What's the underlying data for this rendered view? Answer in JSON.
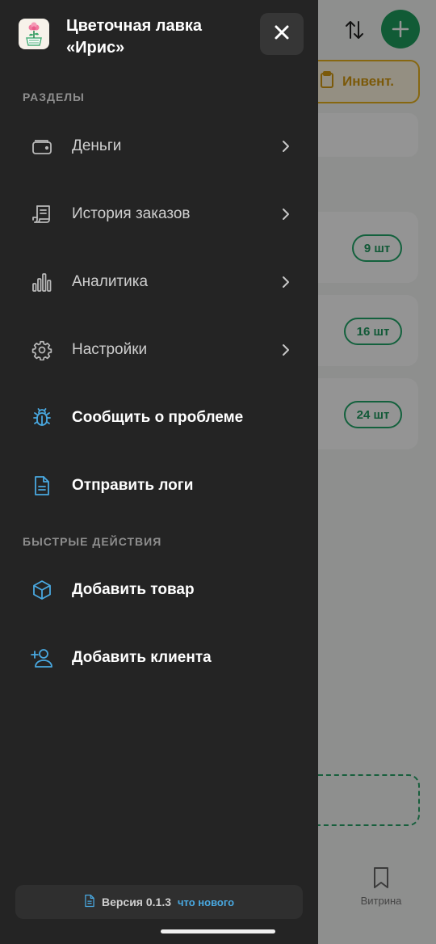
{
  "app": {
    "title": "Цветочная лавка «Ирис»"
  },
  "sections": {
    "main_label": "РАЗДЕЛЫ",
    "quick_label": "БЫСТРЫЕ ДЕЙСТВИЯ"
  },
  "menu": [
    {
      "label": "Деньги",
      "icon": "wallet-icon",
      "chevron": true
    },
    {
      "label": "История заказов",
      "icon": "receipt-icon",
      "chevron": true
    },
    {
      "label": "Аналитика",
      "icon": "bar-chart-icon",
      "chevron": true
    },
    {
      "label": "Настройки",
      "icon": "gear-icon",
      "chevron": true
    },
    {
      "label": "Сообщить о проблеме",
      "icon": "bug-icon",
      "chevron": false
    },
    {
      "label": "Отправить логи",
      "icon": "document-icon",
      "chevron": false
    }
  ],
  "quick_actions": [
    {
      "label": "Добавить товар",
      "icon": "box-icon"
    },
    {
      "label": "Добавить клиента",
      "icon": "add-user-icon"
    }
  ],
  "footer": {
    "version": "Версия 0.1.3",
    "whats_new": "что нового"
  },
  "background": {
    "invent_label": "Инвент.",
    "badges": [
      "9 шт",
      "16 шт",
      "24 шт"
    ],
    "tab_label": "Витрина"
  },
  "colors": {
    "drawer_bg": "#242424",
    "accent_green": "#1e9e5e",
    "accent_blue": "#49a8e0",
    "accent_yellow": "#e8b21c"
  }
}
